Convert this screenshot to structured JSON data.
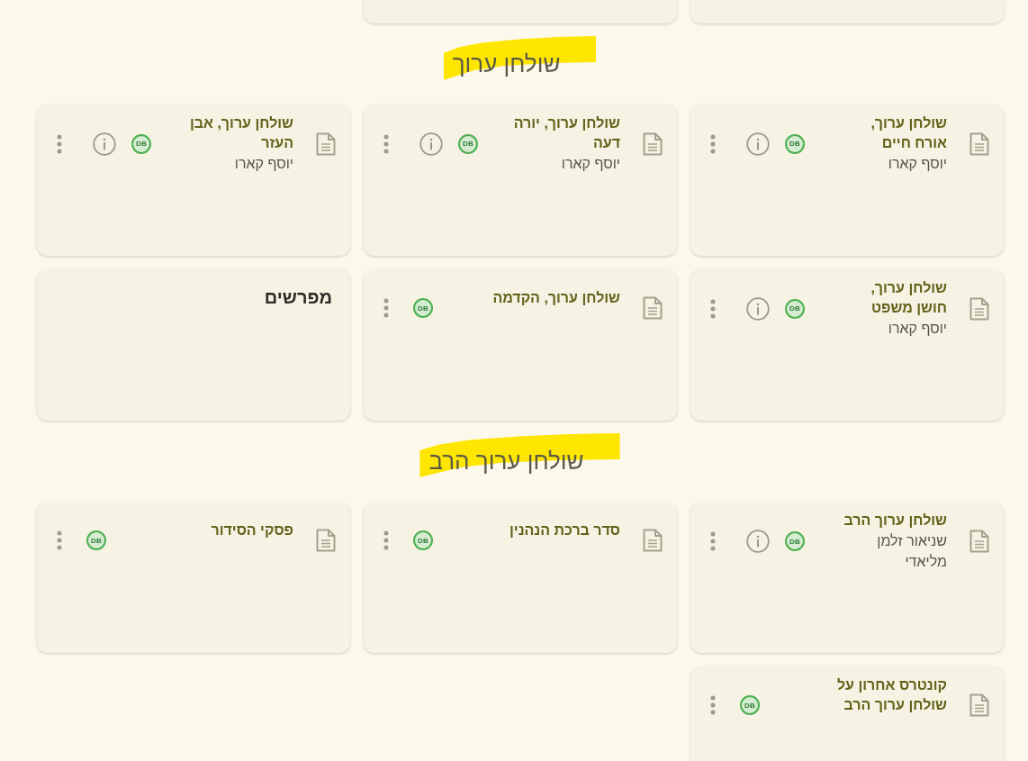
{
  "sections": [
    {
      "cards": [
        {
          "kind": "clipped"
        },
        {
          "kind": "clipped"
        }
      ]
    },
    {
      "title": "שולחן ערוך",
      "cards": [
        {
          "kind": "book",
          "title": "שולחן ערוך,\nאורח חיים",
          "author": "יוסף קארו",
          "badge": "DB",
          "has_info": true
        },
        {
          "kind": "book",
          "title": "שולחן ערוך, יורה\nדעה",
          "author": "יוסף קארו",
          "badge": "DB",
          "has_info": true
        },
        {
          "kind": "book",
          "title": "שולחן ערוך, אבן\nהעזר",
          "author": "יוסף קארו",
          "badge": "DB",
          "has_info": true
        },
        {
          "kind": "book",
          "title": "שולחן ערוך,\nחושן משפט",
          "author": "יוסף קארו",
          "badge": "DB",
          "has_info": true
        },
        {
          "kind": "book",
          "title": "שולחן ערוך, הקדמה",
          "badge": "DB",
          "has_info": false
        },
        {
          "kind": "category",
          "title": "מפרשים"
        }
      ]
    },
    {
      "title": "שולחן ערוך הרב",
      "cards": [
        {
          "kind": "book",
          "title": "שולחן ערוך הרב",
          "author": "שניאור זלמן מליאדי",
          "badge": "DB",
          "has_info": true
        },
        {
          "kind": "book",
          "title": "סדר ברכת הנהנין",
          "badge": "DB",
          "has_info": false
        },
        {
          "kind": "book",
          "title": "פסקי הסידור",
          "badge": "DB",
          "has_info": false
        },
        {
          "kind": "book",
          "title": "קונטרס אחרון על\nשולחן ערוך הרב",
          "badge": "DB",
          "has_info": false
        }
      ]
    }
  ]
}
